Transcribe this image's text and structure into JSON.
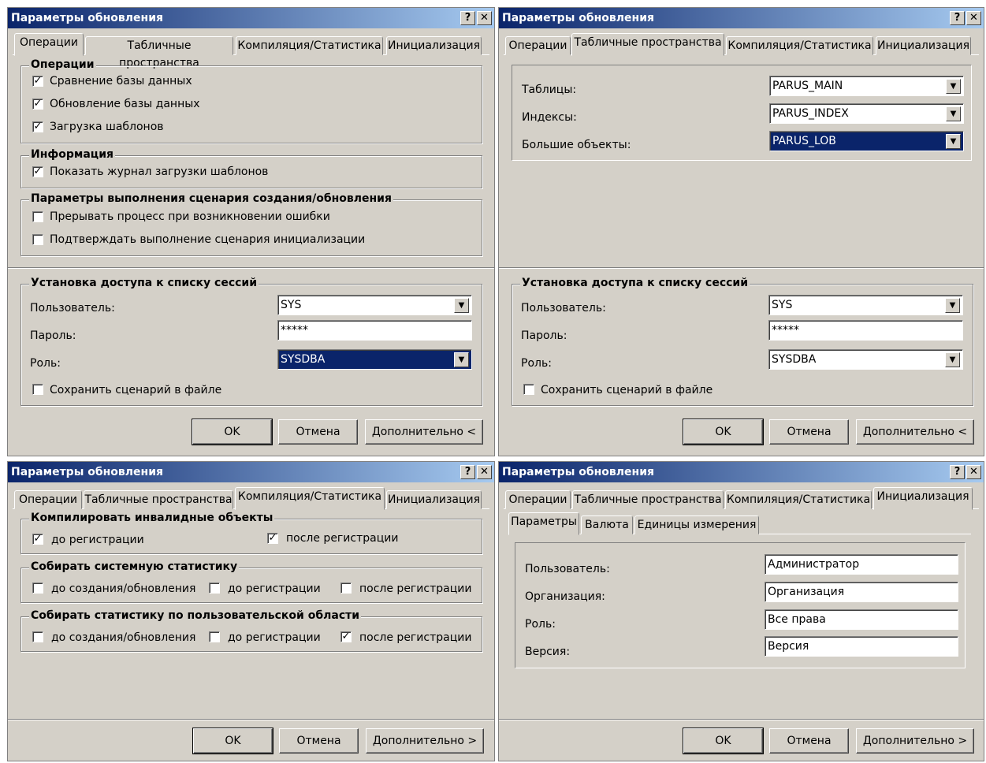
{
  "title": "Параметры обновления",
  "help": "?",
  "close": "✕",
  "tabs": [
    "Операции",
    "Табличные пространства",
    "Компиляция/Статистика",
    "Инициализация"
  ],
  "buttons": {
    "ok": "OK",
    "cancel": "Отмена",
    "more_open": "Дополнительно <",
    "more_closed": "Дополнительно >"
  },
  "access": {
    "title": "Установка доступа к списку сессий",
    "user_label": "Пользователь:",
    "password_label": "Пароль:",
    "role_label": "Роль:",
    "user": "SYS",
    "password": "*****",
    "role": "SYSDBA",
    "save_script": "Сохранить сценарий в файле"
  },
  "ops": {
    "group1": "Операции",
    "compare": "Сравнение базы данных",
    "update": "Обновление базы данных",
    "templates": "Загрузка шаблонов",
    "group2": "Информация",
    "show_log": "Показать журнал загрузки шаблонов",
    "group3": "Параметры выполнения сценария создания/обновления",
    "abort": "Прерывать процесс при возникновении ошибки",
    "confirm": "Подтверждать выполнение сценария инициализации"
  },
  "ts": {
    "tables_label": "Таблицы:",
    "indexes_label": "Индексы:",
    "lob_label": "Большие объекты:",
    "tables": "PARUS_MAIN",
    "indexes": "PARUS_INDEX",
    "lob": "PARUS_LOB"
  },
  "comp": {
    "group1": "Компилировать инвалидные объекты",
    "before_reg": "до регистрации",
    "after_reg": "после регистрации",
    "group2": "Собирать системную статистику",
    "before_create": "до создания/обновления",
    "group3": "Собирать статистику по пользовательской области"
  },
  "init": {
    "subtabs": [
      "Параметры",
      "Валюта",
      "Единицы измерения"
    ],
    "user_label": "Пользователь:",
    "org_label": "Организация:",
    "role_label": "Роль:",
    "version_label": "Версия:",
    "user": "Администратор",
    "org": "Организация",
    "role": "Все права",
    "version": "Версия"
  }
}
